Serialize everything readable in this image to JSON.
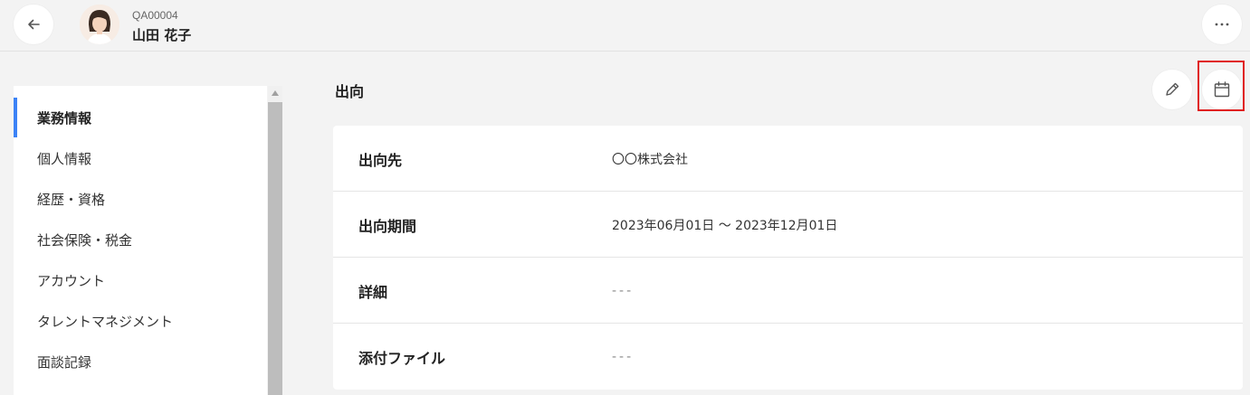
{
  "header": {
    "back_icon": "arrow-left-icon",
    "employee_id": "QA00004",
    "employee_name": "山田 花子",
    "more_icon": "more-horizontal-icon"
  },
  "sidebar": {
    "items": [
      {
        "label": "業務情報",
        "active": true
      },
      {
        "label": "個人情報",
        "active": false
      },
      {
        "label": "経歴・資格",
        "active": false
      },
      {
        "label": "社会保険・税金",
        "active": false
      },
      {
        "label": "アカウント",
        "active": false
      },
      {
        "label": "タレントマネジメント",
        "active": false
      },
      {
        "label": "面談記録",
        "active": false
      }
    ]
  },
  "section": {
    "title": "出向",
    "edit_icon": "pencil-icon",
    "calendar_icon": "calendar-icon"
  },
  "details": {
    "rows": [
      {
        "label": "出向先",
        "value": "〇〇株式会社"
      },
      {
        "label": "出向期間",
        "value": "2023年06月01日 〜 2023年12月01日"
      },
      {
        "label": "詳細",
        "value": "---"
      },
      {
        "label": "添付ファイル",
        "value": "---"
      }
    ]
  },
  "colors": {
    "background": "#f3f3f3",
    "card": "#ffffff",
    "active_accent": "#3b82f6",
    "highlight": "#e01e1e"
  }
}
